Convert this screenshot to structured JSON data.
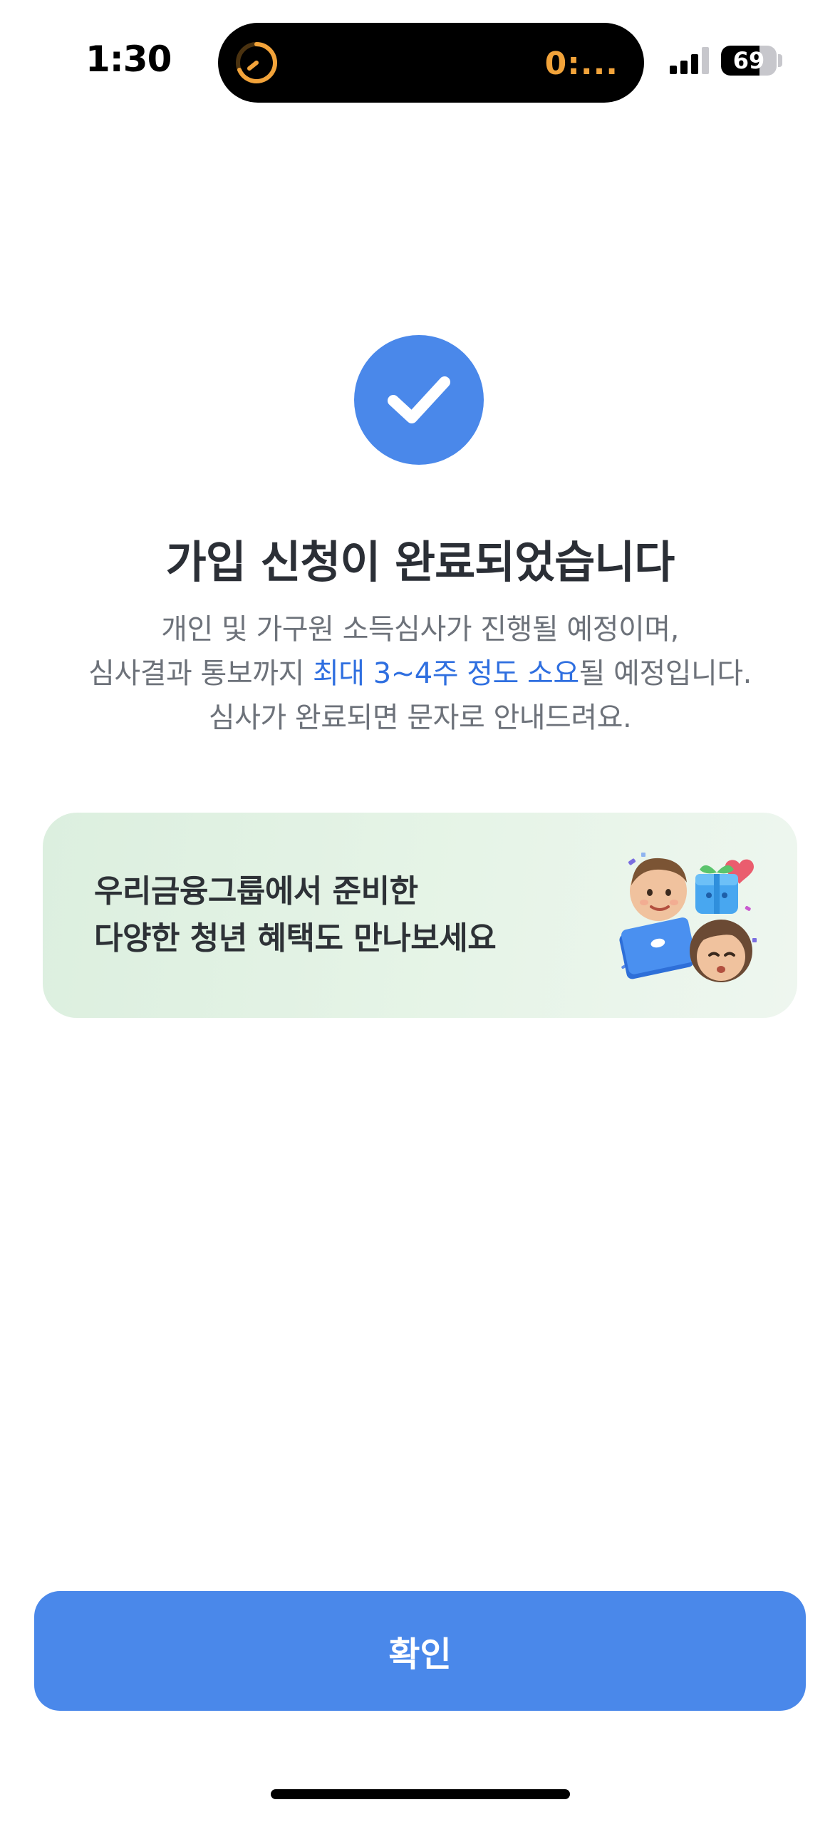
{
  "status_bar": {
    "time": "1:30",
    "island_text": "0:...",
    "battery_level": "69",
    "battery_fraction": 0.69
  },
  "main": {
    "title": "가입 신청이 완료되었습니다",
    "desc_line1": "개인 및 가구원 소득심사가 진행될 예정이며,",
    "desc_line2_pre": "심사결과 통보까지 ",
    "desc_line2_highlight": "최대 3~4주 정도 소요",
    "desc_line2_post": "될 예정입니다.",
    "desc_line3": "심사가 완료되면 문자로 안내드려요."
  },
  "banner": {
    "line1": "우리금융그룹에서 준비한",
    "line2": "다양한 청년 혜택도 만나보세요",
    "icon": "characters-gift-illustration"
  },
  "confirm_button_label": "확인",
  "colors": {
    "accent": "#4a88ea",
    "highlight_text": "#2f6fe0",
    "banner_bg": "#e3f2e4"
  }
}
